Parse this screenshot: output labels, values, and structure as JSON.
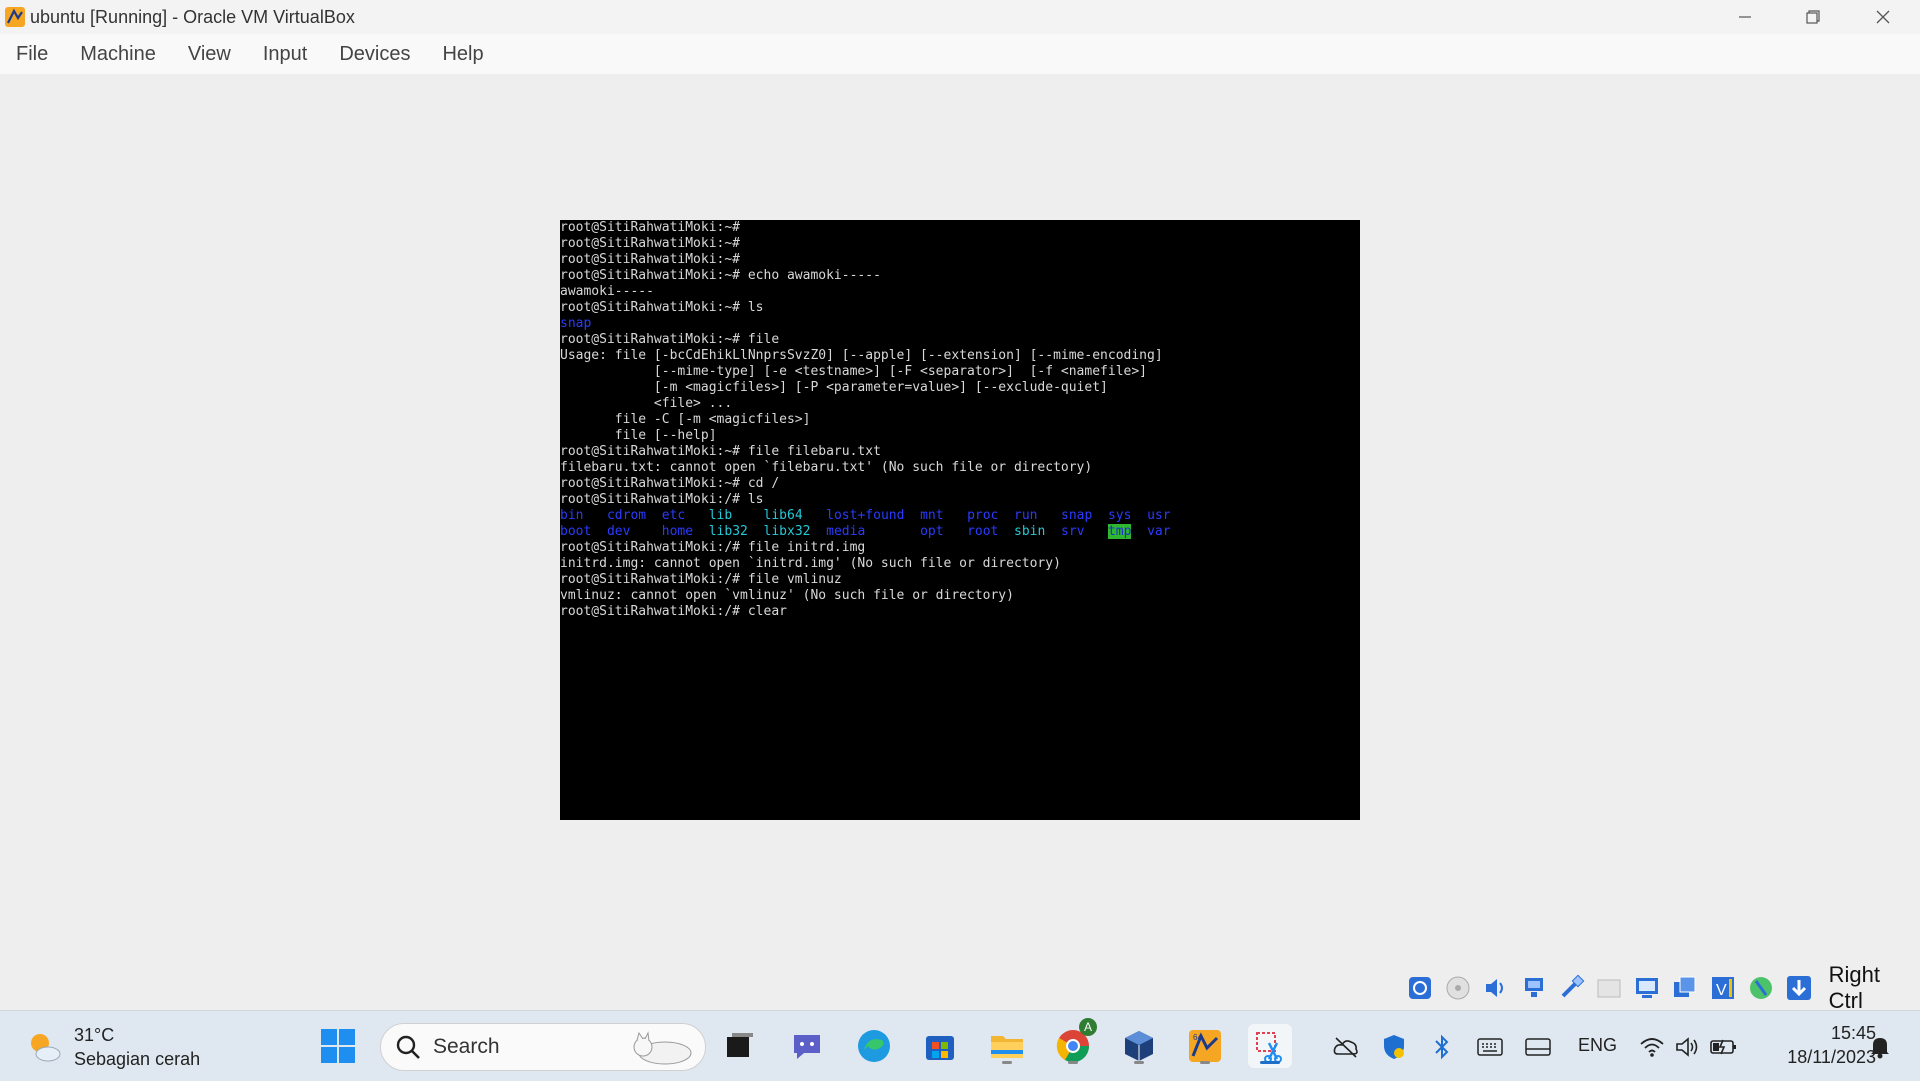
{
  "window": {
    "title": "ubuntu [Running] - Oracle VM VirtualBox",
    "controls": [
      "minimize-icon",
      "restore-icon",
      "close-icon"
    ]
  },
  "menu": [
    "File",
    "Machine",
    "View",
    "Input",
    "Devices",
    "Help"
  ],
  "terminal": {
    "lines": [
      [
        {
          "t": "root@SitiRahwatiMoki:~#"
        }
      ],
      [
        {
          "t": "root@SitiRahwatiMoki:~#"
        }
      ],
      [
        {
          "t": "root@SitiRahwatiMoki:~#"
        }
      ],
      [
        {
          "t": "root@SitiRahwatiMoki:~# echo awamoki-----"
        }
      ],
      [
        {
          "t": "awamoki-----"
        }
      ],
      [
        {
          "t": "root@SitiRahwatiMoki:~# ls"
        }
      ],
      [
        {
          "t": "snap",
          "c": "blue"
        }
      ],
      [
        {
          "t": "root@SitiRahwatiMoki:~# file"
        }
      ],
      [
        {
          "t": "Usage: file [-bcCdEhikLlNnprsSvzZ0] [--apple] [--extension] [--mime-encoding]"
        }
      ],
      [
        {
          "t": "            [--mime-type] [-e <testname>] [-F <separator>]  [-f <namefile>]"
        }
      ],
      [
        {
          "t": "            [-m <magicfiles>] [-P <parameter=value>] [--exclude-quiet]"
        }
      ],
      [
        {
          "t": "            <file> ..."
        }
      ],
      [
        {
          "t": "       file -C [-m <magicfiles>]"
        }
      ],
      [
        {
          "t": "       file [--help]"
        }
      ],
      [
        {
          "t": "root@SitiRahwatiMoki:~# file filebaru.txt"
        }
      ],
      [
        {
          "t": "filebaru.txt: cannot open `filebaru.txt' (No such file or directory)"
        }
      ],
      [
        {
          "t": "root@SitiRahwatiMoki:~# cd /"
        }
      ],
      [
        {
          "t": "root@SitiRahwatiMoki:/# ls"
        }
      ],
      [
        {
          "t": "bin",
          "c": "blue"
        },
        {
          "t": "   "
        },
        {
          "t": "cdrom",
          "c": "blue"
        },
        {
          "t": "  "
        },
        {
          "t": "etc",
          "c": "blue"
        },
        {
          "t": "   "
        },
        {
          "t": "lib",
          "c": "cyan"
        },
        {
          "t": "    "
        },
        {
          "t": "lib64",
          "c": "cyan"
        },
        {
          "t": "   "
        },
        {
          "t": "lost+found",
          "c": "blue"
        },
        {
          "t": "  "
        },
        {
          "t": "mnt",
          "c": "blue"
        },
        {
          "t": "   "
        },
        {
          "t": "proc",
          "c": "blue"
        },
        {
          "t": "  "
        },
        {
          "t": "run",
          "c": "blue"
        },
        {
          "t": "   "
        },
        {
          "t": "snap",
          "c": "blue"
        },
        {
          "t": "  "
        },
        {
          "t": "sys",
          "c": "blue"
        },
        {
          "t": "  "
        },
        {
          "t": "usr",
          "c": "blue"
        }
      ],
      [
        {
          "t": "boot",
          "c": "blue"
        },
        {
          "t": "  "
        },
        {
          "t": "dev",
          "c": "blue"
        },
        {
          "t": "    "
        },
        {
          "t": "home",
          "c": "blue"
        },
        {
          "t": "  "
        },
        {
          "t": "lib32",
          "c": "cyan"
        },
        {
          "t": "  "
        },
        {
          "t": "libx32",
          "c": "cyan"
        },
        {
          "t": "  "
        },
        {
          "t": "media",
          "c": "blue"
        },
        {
          "t": "       "
        },
        {
          "t": "opt",
          "c": "blue"
        },
        {
          "t": "   "
        },
        {
          "t": "root",
          "c": "blue"
        },
        {
          "t": "  "
        },
        {
          "t": "sbin",
          "c": "cyan"
        },
        {
          "t": "  "
        },
        {
          "t": "srv",
          "c": "blue"
        },
        {
          "t": "   "
        },
        {
          "t": "tmp",
          "c": "tmp"
        },
        {
          "t": "  "
        },
        {
          "t": "var",
          "c": "blue"
        }
      ],
      [
        {
          "t": "root@SitiRahwatiMoki:/# file initrd.img"
        }
      ],
      [
        {
          "t": "initrd.img: cannot open `initrd.img' (No such file or directory)"
        }
      ],
      [
        {
          "t": "root@SitiRahwatiMoki:/# file vmlinuz"
        }
      ],
      [
        {
          "t": "vmlinuz: cannot open `vmlinuz' (No such file or directory)"
        }
      ],
      [
        {
          "t": "root@SitiRahwatiMoki:/# clear"
        }
      ]
    ]
  },
  "status_bar": {
    "icons": [
      "hard-disk-icon",
      "optical-drive-icon",
      "audio-icon",
      "network-icon",
      "usb-icon",
      "shared-folders-icon",
      "display-icon",
      "recording-icon",
      "vt-x-icon",
      "guest-additions-icon",
      "download-arrow-icon"
    ],
    "host_key": "Right Ctrl"
  },
  "taskbar": {
    "weather": {
      "temp": "31°C",
      "desc": "Sebagian cerah"
    },
    "search_label": "Search",
    "chrome_badge": "A",
    "lang": "ENG",
    "time": "15:45",
    "date": "18/11/2023"
  },
  "colors": {
    "term_blue": "#2a3bff",
    "term_cyan": "#25c8d6",
    "term_tmp_bg": "#2fb82f"
  }
}
